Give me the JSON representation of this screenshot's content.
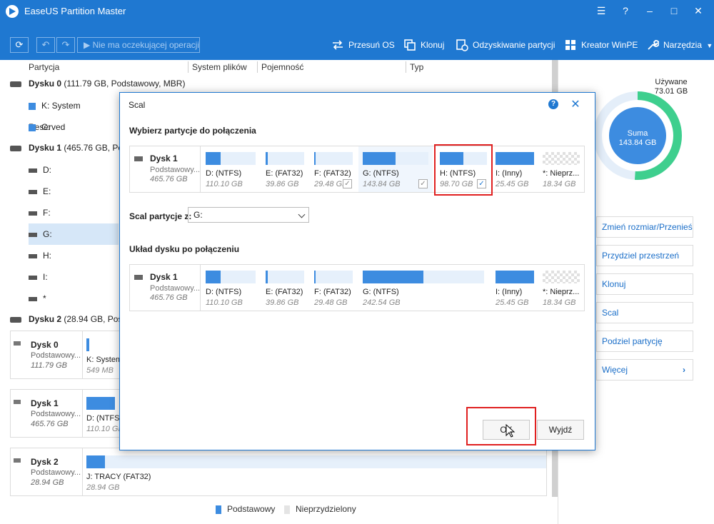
{
  "app": {
    "title": "EaseUS Partition Master",
    "accent": "#1f78d1"
  },
  "window_buttons": [
    "menu-icon",
    "help-icon",
    "minimize-icon",
    "maximize-icon",
    "close-icon"
  ],
  "toolbar": {
    "pending": "Nie ma oczekującej operacji",
    "tools": [
      "Przesuń OS",
      "Klonuj",
      "Odzyskiwanie partycji",
      "Kreator WinPE",
      "Narzędzia"
    ]
  },
  "table": {
    "columns": [
      "Partycja",
      "System plików",
      "Pojemność",
      "Typ"
    ]
  },
  "tree": {
    "disk0": "Dysku 0",
    "disk0_info": "(111.79 GB, Podstawowy, MBR)",
    "disk0_parts": [
      "K: System Reserved",
      "C:"
    ],
    "disk1": "Dysku 1",
    "disk1_info": "(465.76 GB, Pod",
    "disk1_parts": [
      "D:",
      "E:",
      "F:",
      "G:",
      "H:",
      "I:",
      "*"
    ],
    "disk2": "Dysku 2",
    "disk2_info": "(28.94 GB, Pos"
  },
  "cards": [
    {
      "name": "Dysk 0",
      "type": "Podstawowy...",
      "size": "111.79 GB",
      "part_label": "K: System",
      "part_size": "549 MB"
    },
    {
      "name": "Dysk 1",
      "type": "Podstawowy...",
      "size": "465.76 GB",
      "part_label": "D: (NTFS",
      "part_size": "110.10 GB"
    },
    {
      "name": "Dysk 2",
      "type": "Podstawowy...",
      "size": "28.94 GB",
      "part_label": "J: TRACY (FAT32)",
      "part_size": "28.94 GB"
    }
  ],
  "legend": {
    "basic": "Podstawowy",
    "unallocated": "Nieprzydzielony"
  },
  "sidebar": {
    "used_label": "Używane",
    "used_value": "73.01 GB",
    "total_label": "Suma",
    "total_value": "143.84 GB",
    "used_fraction": 0.51,
    "actions": [
      "Zmień rozmiar/Przenieś",
      "Przydziel przestrzeń",
      "Klonuj",
      "Scal",
      "Podziel partycję",
      "Więcej"
    ]
  },
  "dialog": {
    "title": "Scal",
    "select_heading": "Wybierz partycje do połączenia",
    "merge_into_label": "Scal partycje z:",
    "merge_into_value": "G:",
    "layout_heading": "Układ dysku po połączeniu",
    "disk_name": "Dysk 1",
    "disk_type": "Podstawowy...",
    "disk_size": "465.76 GB",
    "before": [
      {
        "label": "D: (NTFS)",
        "size": "110.10 GB",
        "fill": 0.3
      },
      {
        "label": "E: (FAT32)",
        "size": "39.86 GB",
        "fill": 0.05
      },
      {
        "label": "F: (FAT32)",
        "size": "29.48 GB",
        "fill": 0.03
      },
      {
        "label": "G: (NTFS)",
        "size": "143.84 GB",
        "fill": 0.5
      },
      {
        "label": "H: (NTFS)",
        "size": "98.70 GB",
        "fill": 0.5
      },
      {
        "label": "I: (Inny)",
        "size": "25.45 GB",
        "fill": 1.0
      },
      {
        "label": "*: Nieprz...",
        "size": "18.34 GB",
        "fill": 0
      }
    ],
    "after": [
      {
        "label": "D: (NTFS)",
        "size": "110.10 GB",
        "fill": 0.3
      },
      {
        "label": "E: (FAT32)",
        "size": "39.86 GB",
        "fill": 0.05
      },
      {
        "label": "F: (FAT32)",
        "size": "29.48 GB",
        "fill": 0.03
      },
      {
        "label": "G: (NTFS)",
        "size": "242.54 GB",
        "fill": 0.5
      },
      {
        "label": "I: (Inny)",
        "size": "25.45 GB",
        "fill": 1.0
      },
      {
        "label": "*: Nieprz...",
        "size": "18.34 GB",
        "fill": 0
      }
    ],
    "ok": "OK",
    "exit": "Wyjdź"
  }
}
